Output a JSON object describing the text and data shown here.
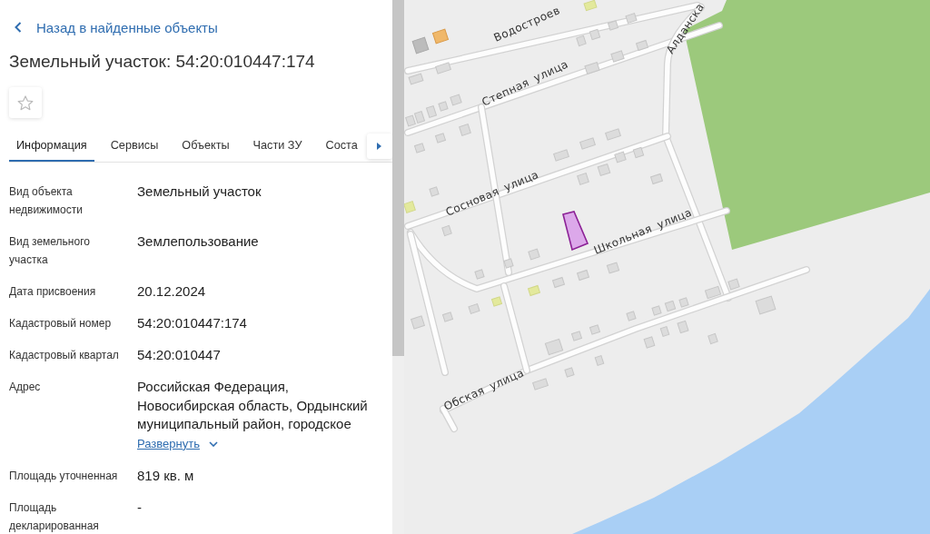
{
  "back_link": {
    "label": "Назад в найденные объекты"
  },
  "title": "Земельный участок: 54:20:010447:174",
  "favorite": {
    "on": false
  },
  "tabs": [
    {
      "label": "Информация",
      "selected": true
    },
    {
      "label": "Сервисы",
      "selected": false
    },
    {
      "label": "Объекты",
      "selected": false
    },
    {
      "label": "Части ЗУ",
      "selected": false
    },
    {
      "label": "Соста",
      "selected": false
    }
  ],
  "properties": [
    {
      "label": "Вид объекта недвижимости",
      "value": "Земельный участок"
    },
    {
      "label": "Вид земельного участка",
      "value": "Землепользование"
    },
    {
      "label": "Дата присвоения",
      "value": "20.12.2024"
    },
    {
      "label": "Кадастровый номер",
      "value": "54:20:010447:174"
    },
    {
      "label": "Кадастровый квартал",
      "value": "54:20:010447"
    },
    {
      "label": "Адрес",
      "value": "Российская Федерация, Новосибирская область, Ордынский муниципальный район, городское",
      "expand_link": "Развернуть"
    },
    {
      "label": "Площадь уточненная",
      "value": "819 кв. м"
    },
    {
      "label": "Площадь декларированная",
      "value": "-"
    }
  ],
  "map": {
    "streets": [
      {
        "name": "Водостроев"
      },
      {
        "name": "Алданска"
      },
      {
        "name": "Степная улица"
      },
      {
        "name": "Сосновая улица"
      },
      {
        "name": "Школьная улица"
      },
      {
        "name": "Обская улица"
      }
    ]
  }
}
